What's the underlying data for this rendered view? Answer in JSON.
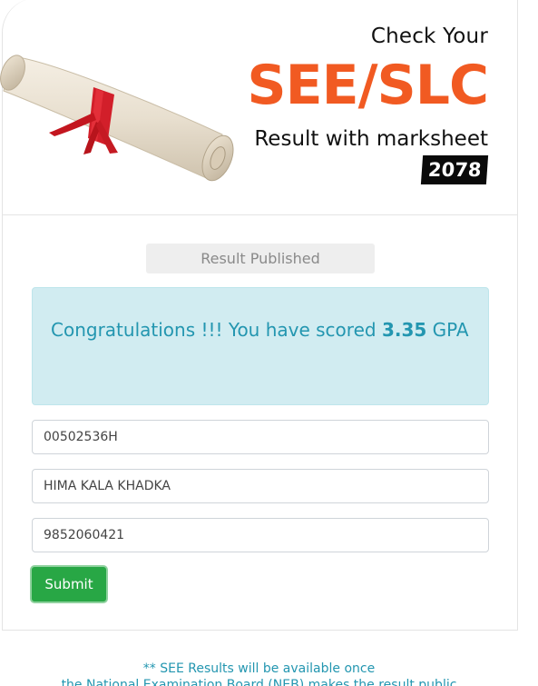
{
  "header": {
    "check_text": "Check Your",
    "title": "SEE/SLC",
    "subtitle": "Result with marksheet",
    "year": "2078",
    "image_name": "diploma-scroll"
  },
  "status": {
    "label": "Result Published"
  },
  "result": {
    "message_prefix": "Congratulations !!! You have scored",
    "score": "3.35",
    "unit": "GPA"
  },
  "form": {
    "symbol_number": "00502536H",
    "student_name": "HIMA KALA KHADKA",
    "phone_number": "9852060421",
    "submit_label": "Submit"
  },
  "footer": {
    "line1": "** SEE Results will be available once",
    "line2": "the National Examination Board (NEB) makes the result public"
  },
  "colors": {
    "accent_orange": "#f15a22",
    "alert_text": "#2396b0",
    "alert_bg": "#d1ecf1",
    "button_green": "#28a745"
  }
}
